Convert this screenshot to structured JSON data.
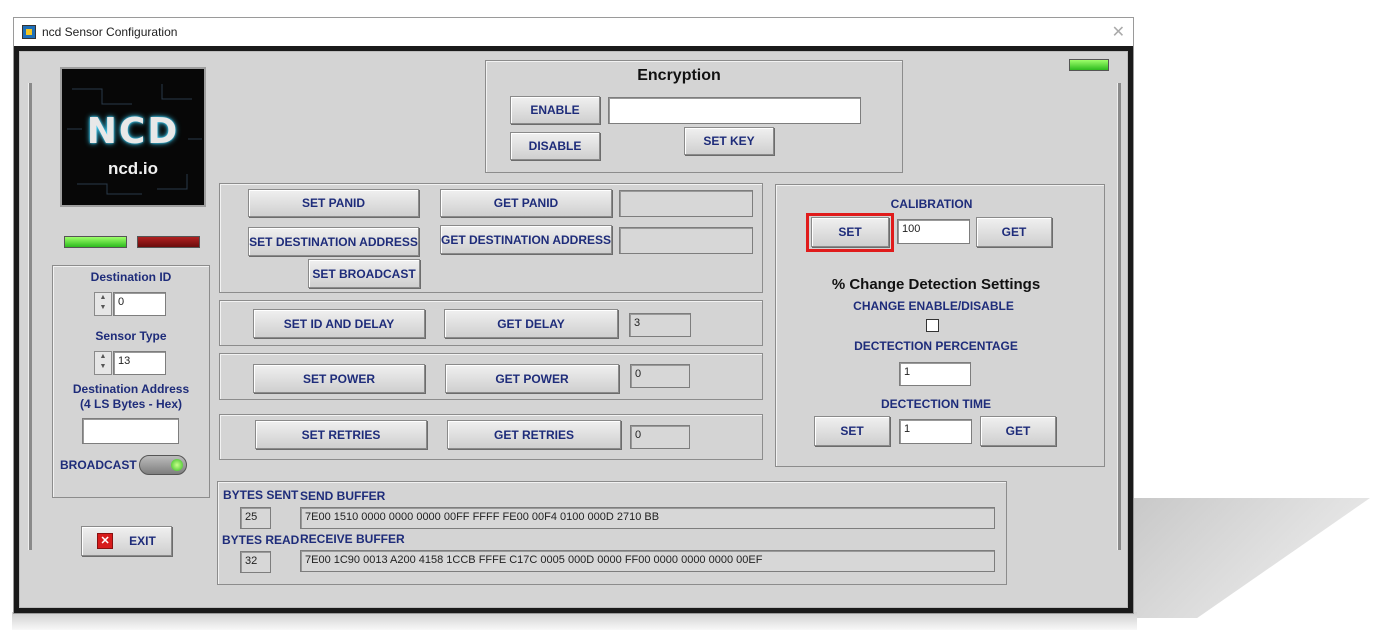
{
  "window": {
    "title": "ncd Sensor Configuration",
    "close_glyph": "✕"
  },
  "logo": {
    "main": "NCD",
    "sub": "ncd.io"
  },
  "encryption": {
    "title": "Encryption",
    "enable": "ENABLE",
    "disable": "DISABLE",
    "set_key": "SET KEY",
    "key_value": ""
  },
  "network": {
    "set_panid": "SET PANID",
    "get_panid": "GET PANID",
    "panid_value": "",
    "set_dest": "SET DESTINATION ADDRESS",
    "get_dest": "GET DESTINATION ADDRESS",
    "dest_value": "",
    "set_broadcast": "SET BROADCAST"
  },
  "delay": {
    "set": "SET ID AND DELAY",
    "get": "GET DELAY",
    "value": "3"
  },
  "power": {
    "set": "SET POWER",
    "get": "GET POWER",
    "value": "0"
  },
  "retries": {
    "set": "SET RETRIES",
    "get": "GET RETRIES",
    "value": "0"
  },
  "left": {
    "dest_id_label": "Destination ID",
    "dest_id_value": "0",
    "sensor_type_label": "Sensor Type",
    "sensor_type_value": "13",
    "dest_addr_label1": "Destination Address",
    "dest_addr_label2": "(4 LS Bytes - Hex)",
    "dest_addr_value": "",
    "broadcast_label": "BROADCAST",
    "exit": "EXIT"
  },
  "calibration": {
    "title": "CALIBRATION",
    "set": "SET",
    "value": "100",
    "get": "GET",
    "change_title": "% Change Detection Settings",
    "change_enable": "CHANGE ENABLE/DISABLE",
    "detection_pct_label": "DECTECTION PERCENTAGE",
    "detection_pct_value": "1",
    "detection_time_label": "DECTECTION TIME",
    "time_set": "SET",
    "time_value": "1",
    "time_get": "GET"
  },
  "buffers": {
    "bytes_sent_label": "BYTES SENT",
    "bytes_sent": "25",
    "send_label": "SEND BUFFER",
    "send": "7E00 1510 0000 0000 0000 00FF FFFF FE00 00F4 0100 000D 2710 BB",
    "bytes_read_label": "BYTES READ",
    "bytes_read": "32",
    "receive_label": "RECEIVE BUFFER",
    "receive": "7E00 1C90 0013 A200 4158 1CCB FFFE C17C 0005 000D 0000 FF00 0000 0000 0000 00EF"
  },
  "colors": {
    "label_blue": "#1e2c7a",
    "led_green": "#3fd42e",
    "led_red": "#8a1010",
    "highlight": "#e01b1b"
  }
}
